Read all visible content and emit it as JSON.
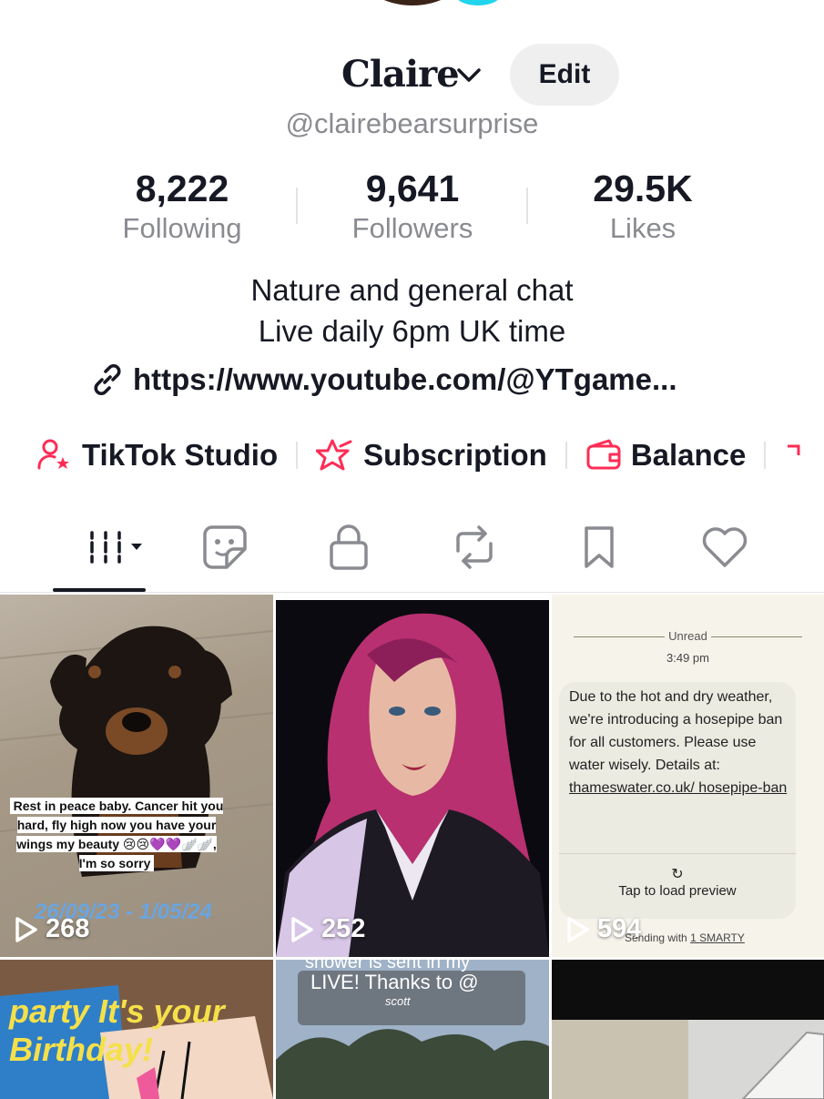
{
  "profile": {
    "name": "Claire",
    "edit_label": "Edit",
    "handle": "@clairebearsurprise"
  },
  "stats": [
    {
      "value": "8,222",
      "label": "Following"
    },
    {
      "value": "9,641",
      "label": "Followers"
    },
    {
      "value": "29.5K",
      "label": "Likes"
    }
  ],
  "bio": {
    "line1": "Nature and general chat",
    "line2": "Live daily 6pm UK time",
    "link": "https://www.youtube.com/@YTgame..."
  },
  "quick_actions": [
    {
      "label": "TikTok Studio",
      "icon": "person-star-icon"
    },
    {
      "label": "Subscription",
      "icon": "star-badge-icon"
    },
    {
      "label": "Balance",
      "icon": "wallet-icon"
    }
  ],
  "tabs": [
    {
      "name": "videos",
      "icon": "grid-icon",
      "active": true
    },
    {
      "name": "stickers",
      "icon": "sticker-icon"
    },
    {
      "name": "private",
      "icon": "lock-icon"
    },
    {
      "name": "reposts",
      "icon": "repost-icon"
    },
    {
      "name": "favorites",
      "icon": "bookmark-icon"
    },
    {
      "name": "liked",
      "icon": "heart-icon"
    }
  ],
  "videos": [
    {
      "views": "268",
      "caption": "Rest in peace baby. Cancer hit you hard, fly high now you have your wings my beauty 😢😢💜💜🪽🪽, I'm so sorry",
      "overlay_date": "26/09/23 - 1/05/24"
    },
    {
      "views": "252"
    },
    {
      "views": "594",
      "sms_unread": "Unread",
      "sms_time": "3:49 pm",
      "sms_text": "Due to the hot and dry weather, we're introducing a hosepipe ban for all customers. Please use water wisely. Details at:",
      "sms_link": "thameswater.co.uk/ hosepipe-ban",
      "sms_preview": "Tap to load preview",
      "sms_send_prefix": "Sending with",
      "sms_send_link": "1 SMARTY"
    },
    {
      "caption": "party It's your Birthday!"
    },
    {
      "caption_top": "shower is sent in my",
      "caption": "LIVE! Thanks to @",
      "sub": "scott"
    },
    {}
  ],
  "colors": {
    "accent": "#fe2c55",
    "text": "#161823",
    "muted": "#8a8b91",
    "chip_bg": "#efefef"
  }
}
